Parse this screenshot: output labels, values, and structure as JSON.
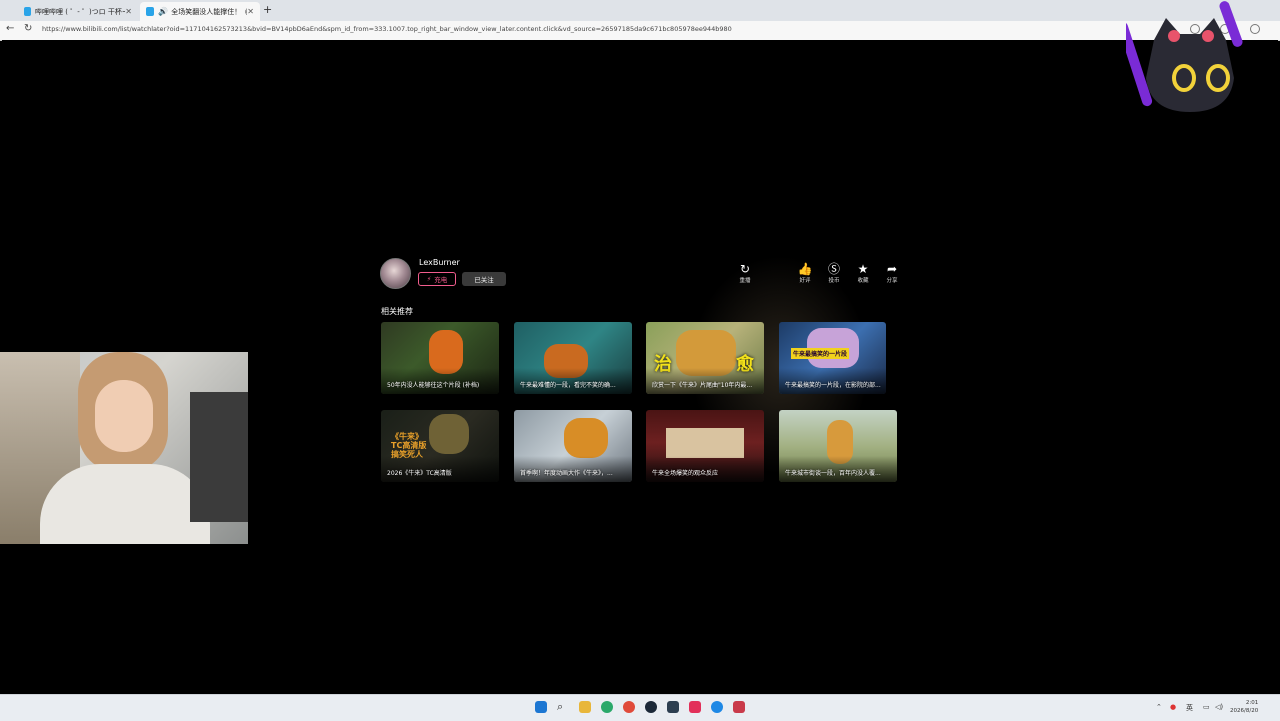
{
  "browser": {
    "tabs": [
      {
        "title": "哔哩哔哩 ( ゜- ゜)つロ 干杯~-bilibili"
      },
      {
        "title": "全场笑翻没人能撑住！《牛来》"
      }
    ],
    "url": "https://www.bilibili.com/list/watchlater?oid=117104162573213&bvid=BV14pbD6aEnd&spm_id_from=333.1007.top_right_bar_window_view_later.content.click&vd_source=26597185da9c671bc805978ee944b980"
  },
  "uploader": {
    "name": "LexBurner",
    "charge_label": "充电",
    "follow_label": "已关注"
  },
  "actions": [
    {
      "icon": "replay-icon",
      "label": "重播"
    },
    {
      "icon": "thumbs-up-icon",
      "label": "好评"
    },
    {
      "icon": "coin-icon",
      "label": "投币"
    },
    {
      "icon": "star-icon",
      "label": "收藏"
    },
    {
      "icon": "share-icon",
      "label": "分享"
    }
  ],
  "recommend": {
    "title": "相关推荐",
    "items": [
      {
        "caption": "50年内没人能够往这个片段 (补档)"
      },
      {
        "caption": "牛来最难懂的一段，看完不笑的确..."
      },
      {
        "caption": "欣赏一下《牛来》片尾曲\"10年内最..."
      },
      {
        "caption": "牛来最搞笑的一片段，在影院的部..."
      },
      {
        "caption": "2026《牛来》TC高清版"
      },
      {
        "caption": "首季啊！年度动画大作《牛来》，..."
      },
      {
        "caption": "牛来全场爆笑的观众反应"
      },
      {
        "caption": "牛来城市街谈一段，百年内没人覆..."
      }
    ],
    "overlay_text": {
      "card3_left": "治",
      "card3_right": "愈",
      "card4_banner": "牛来最搞笑的一片段",
      "card5_line1": "《牛来》",
      "card5_line2": "TC高清版",
      "card5_line3": "搞笑死人"
    }
  },
  "taskbar": {
    "tray_lang": "英",
    "clock_time": "2:01",
    "clock_date": "2026/8/20"
  }
}
